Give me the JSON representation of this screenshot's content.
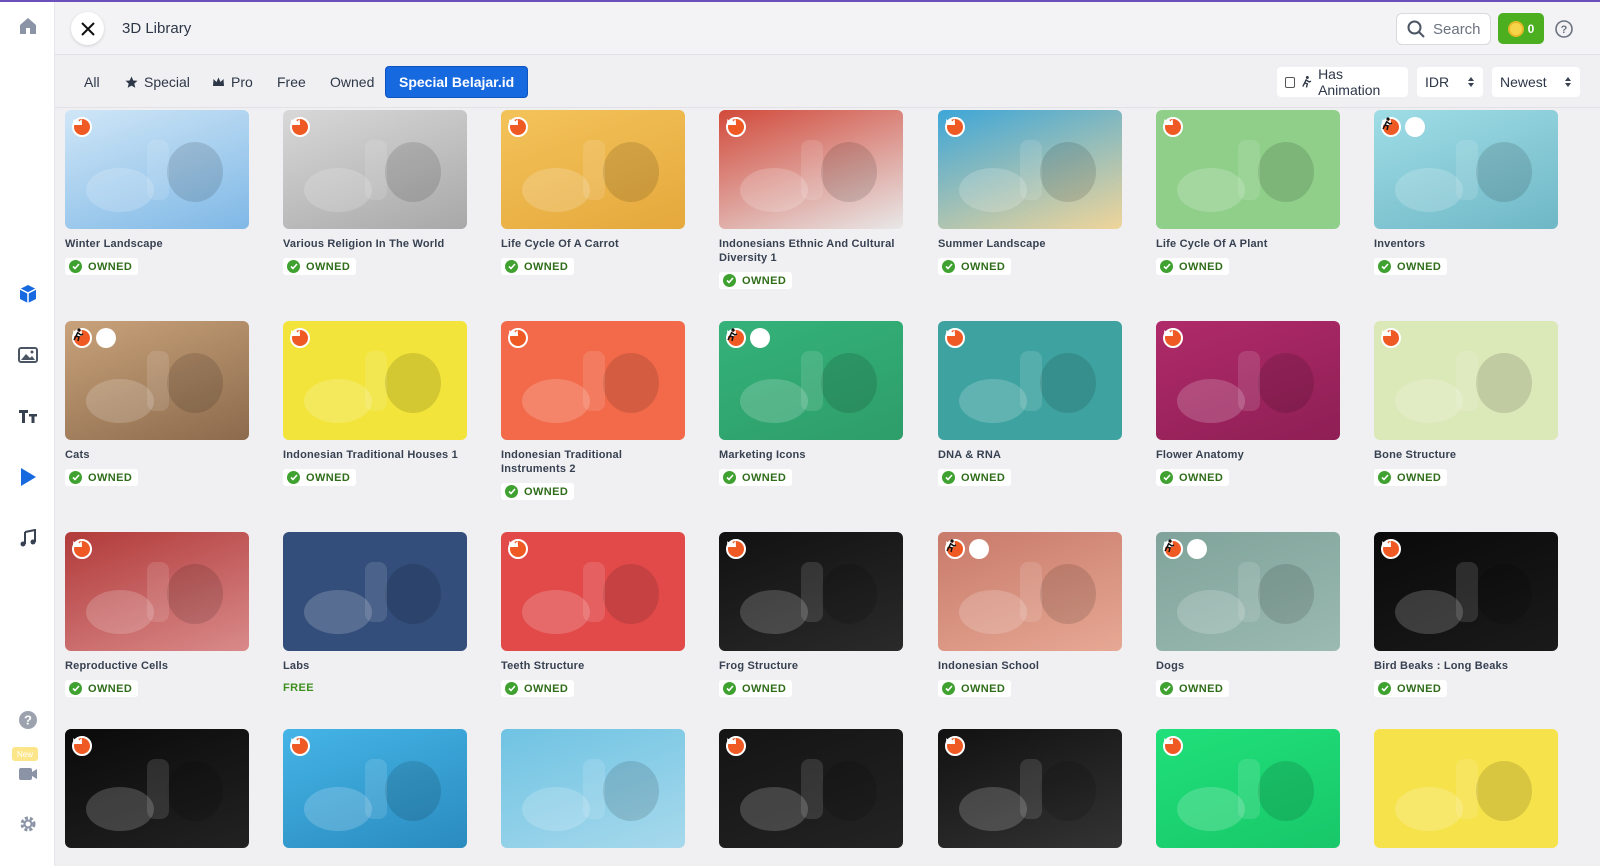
{
  "app": {
    "title": "3D Library",
    "search_placeholder": "Search",
    "coins": "0",
    "accent_color": "#1769e0",
    "owned_color": "#3fa12f",
    "premium_badge_color": "#ef5a24"
  },
  "sidebar": {
    "items": [
      {
        "name": "home-icon"
      },
      {
        "name": "cube-icon"
      },
      {
        "name": "image-icon"
      },
      {
        "name": "text-icon"
      },
      {
        "name": "play-icon"
      },
      {
        "name": "music-icon"
      },
      {
        "name": "help-icon"
      },
      {
        "name": "video-camera-icon"
      },
      {
        "name": "settings-icon"
      }
    ],
    "new_badge": "New"
  },
  "filters": {
    "tabs": [
      {
        "label": "All",
        "icon": ""
      },
      {
        "label": "Special",
        "icon": "star-icon"
      },
      {
        "label": "Pro",
        "icon": "crown-icon"
      },
      {
        "label": "Free",
        "icon": ""
      },
      {
        "label": "Owned",
        "icon": ""
      },
      {
        "label": "Special Belajar.id",
        "icon": "",
        "active": true
      }
    ],
    "has_animation_label": "Has Animation",
    "currency": "IDR",
    "sort": "Newest"
  },
  "cards": [
    {
      "title": "Winter Landscape",
      "status": "OWNED",
      "premium": true,
      "animated": false
    },
    {
      "title": "Various Religion In The World",
      "status": "OWNED",
      "premium": true,
      "animated": false
    },
    {
      "title": "Life Cycle Of A Carrot",
      "status": "OWNED",
      "premium": true,
      "animated": false
    },
    {
      "title": "Indonesians Ethnic And Cultural Diversity 1",
      "status": "OWNED",
      "premium": true,
      "animated": false
    },
    {
      "title": "Summer Landscape",
      "status": "OWNED",
      "premium": true,
      "animated": false
    },
    {
      "title": "Life Cycle Of A Plant",
      "status": "OWNED",
      "premium": true,
      "animated": false
    },
    {
      "title": "Inventors",
      "status": "OWNED",
      "premium": true,
      "animated": true
    },
    {
      "title": "Cats",
      "status": "OWNED",
      "premium": true,
      "animated": true
    },
    {
      "title": "Indonesian Traditional Houses 1",
      "status": "OWNED",
      "premium": true,
      "animated": false
    },
    {
      "title": "Indonesian Traditional Instruments 2",
      "status": "OWNED",
      "premium": true,
      "animated": false
    },
    {
      "title": "Marketing Icons",
      "status": "OWNED",
      "premium": true,
      "animated": true
    },
    {
      "title": "DNA & RNA",
      "status": "OWNED",
      "premium": true,
      "animated": false
    },
    {
      "title": "Flower Anatomy",
      "status": "OWNED",
      "premium": true,
      "animated": false
    },
    {
      "title": "Bone Structure",
      "status": "OWNED",
      "premium": true,
      "animated": false
    },
    {
      "title": "Reproductive Cells",
      "status": "OWNED",
      "premium": true,
      "animated": false
    },
    {
      "title": "Labs",
      "status": "FREE",
      "premium": false,
      "animated": false
    },
    {
      "title": "Teeth Structure",
      "status": "OWNED",
      "premium": true,
      "animated": false
    },
    {
      "title": "Frog Structure",
      "status": "OWNED",
      "premium": true,
      "animated": false
    },
    {
      "title": "Indonesian School",
      "status": "OWNED",
      "premium": true,
      "animated": true
    },
    {
      "title": "Dogs",
      "status": "OWNED",
      "premium": true,
      "animated": true
    },
    {
      "title": "Bird Beaks : Long Beaks",
      "status": "OWNED",
      "premium": true,
      "animated": false
    },
    {
      "title": "",
      "status": "",
      "premium": true,
      "animated": false
    },
    {
      "title": "",
      "status": "",
      "premium": true,
      "animated": false
    },
    {
      "title": "",
      "status": "",
      "premium": false,
      "animated": false
    },
    {
      "title": "",
      "status": "",
      "premium": true,
      "animated": false
    },
    {
      "title": "",
      "status": "",
      "premium": true,
      "animated": false
    },
    {
      "title": "",
      "status": "",
      "premium": true,
      "animated": false
    },
    {
      "title": "",
      "status": "",
      "premium": false,
      "animated": false
    }
  ]
}
